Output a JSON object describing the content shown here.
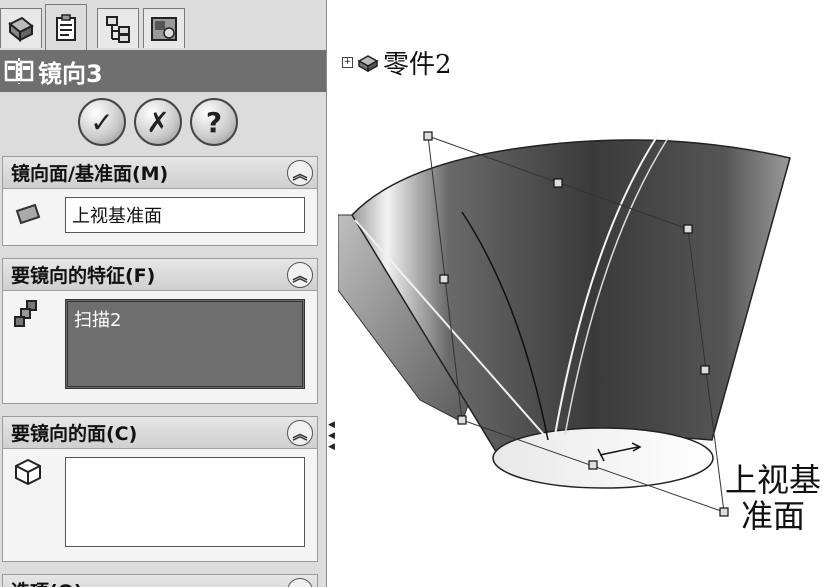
{
  "tabs": [
    {
      "icon": "feature-manager-icon"
    },
    {
      "icon": "property-manager-icon",
      "active": true
    },
    {
      "icon": "configuration-manager-icon"
    },
    {
      "icon": "display-manager-icon"
    }
  ],
  "title": "镜向3",
  "actions": {
    "ok": "✓",
    "cancel": "✗",
    "help": "?"
  },
  "groups": {
    "mirror_plane": {
      "header": "镜向面/基准面(M)",
      "value": "上视基准面"
    },
    "features": {
      "header": "要镜向的特征(F)",
      "value": "扫描2"
    },
    "faces": {
      "header": "要镜向的面(C)",
      "value": ""
    },
    "options": {
      "header": "选项(O)"
    }
  },
  "graphics": {
    "tree_node": "零件2",
    "plane_label_line1": "上视基",
    "plane_label_line2": "准面"
  }
}
